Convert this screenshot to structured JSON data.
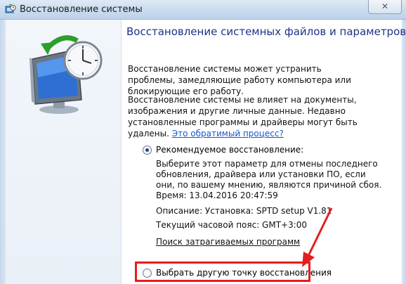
{
  "window": {
    "title": "Восстановление системы",
    "close_label": "✕"
  },
  "content": {
    "heading": "Восстановление системных файлов и параметров",
    "para1": "Восстановление системы может устранить проблемы, замедляющие работу компьютера или блокирующие его работу.",
    "para2_text": "Восстановление системы не влияет на документы, изображения и другие личные данные. Недавно установленные программы и драйверы могут быть удалены.",
    "para2_link": "Это обратимый процесс?",
    "recommended_label": "Рекомендуемое восстановление:",
    "rec_desc_lines": [
      "Выберите этот параметр для отмены последнего",
      "обновления, драйвера или установки ПО, если",
      "они, по вашему мнению, являются причиной сбоя."
    ],
    "time": "Время: 13.04.2016 20:47:59",
    "description": "Описание: Установка: SPTD setup V1.81",
    "timezone": "Текущий часовой пояс: GMT+3:00",
    "affected_link": "Поиск затрагиваемых программ",
    "other_point_label": "Выбрать другую точку восстановления"
  },
  "state": {
    "recommended_selected": true,
    "other_selected": false
  },
  "colors": {
    "heading": "#1e3287",
    "link": "#1a57c9",
    "highlight": "#e41e1e"
  },
  "icons": {
    "title": "system-restore-icon",
    "illustration": "monitor-with-clock-restore-icon"
  }
}
